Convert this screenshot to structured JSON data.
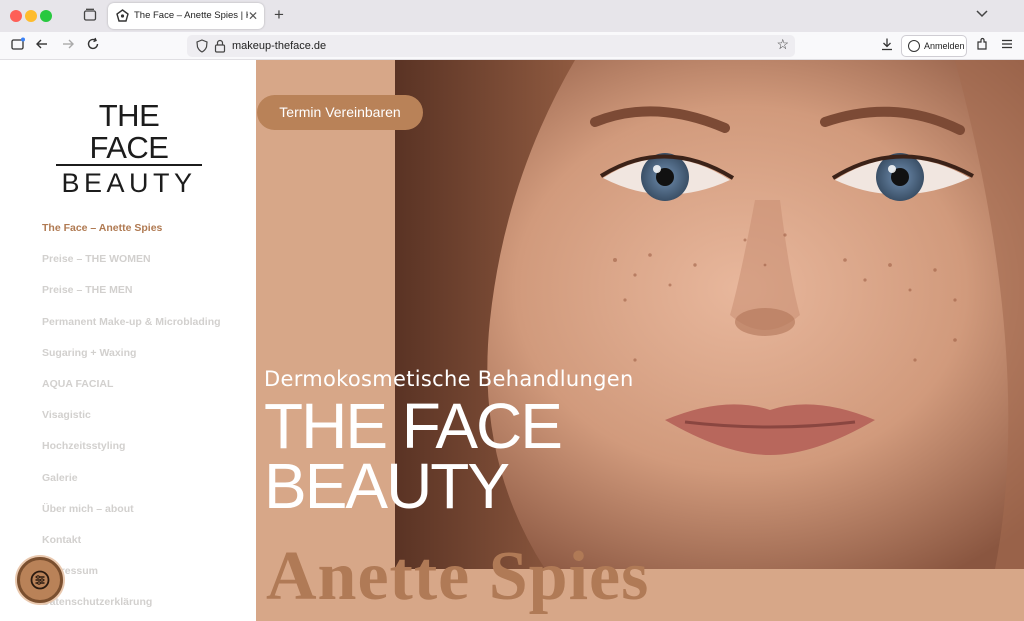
{
  "browser": {
    "tab_title": "The Face – Anette Spies | Kosmetik",
    "url": "makeup-theface.de",
    "signin_label": "Anmelden"
  },
  "sidebar": {
    "logo_line1": "THE FACE",
    "logo_line2": "BEAUTY",
    "menu": [
      "The Face – Anette Spies",
      "Preise – THE WOMEN",
      "Preise – THE MEN",
      "Permanent Make-up & Microblading",
      "Sugaring + Waxing",
      "AQUA FACIAL",
      "Visagistic",
      "Hochzeitsstyling",
      "Galerie",
      "Über mich – about",
      "Kontakt",
      "Impressum",
      "Datenschutzerklärung"
    ]
  },
  "hero": {
    "cta_label": "Termin Vereinbaren",
    "kicker": "Dermokosmetische Behandlungen",
    "headline_line1": "THE FACE",
    "headline_line2": "BEAUTY",
    "name": "Anette Spies"
  },
  "icons": {
    "accessibility": "sliders-icon",
    "photo": "portrait-photo"
  },
  "colors": {
    "accent": "#b98258",
    "active_menu": "#b07a52",
    "hero_bg": "#d7a788"
  }
}
